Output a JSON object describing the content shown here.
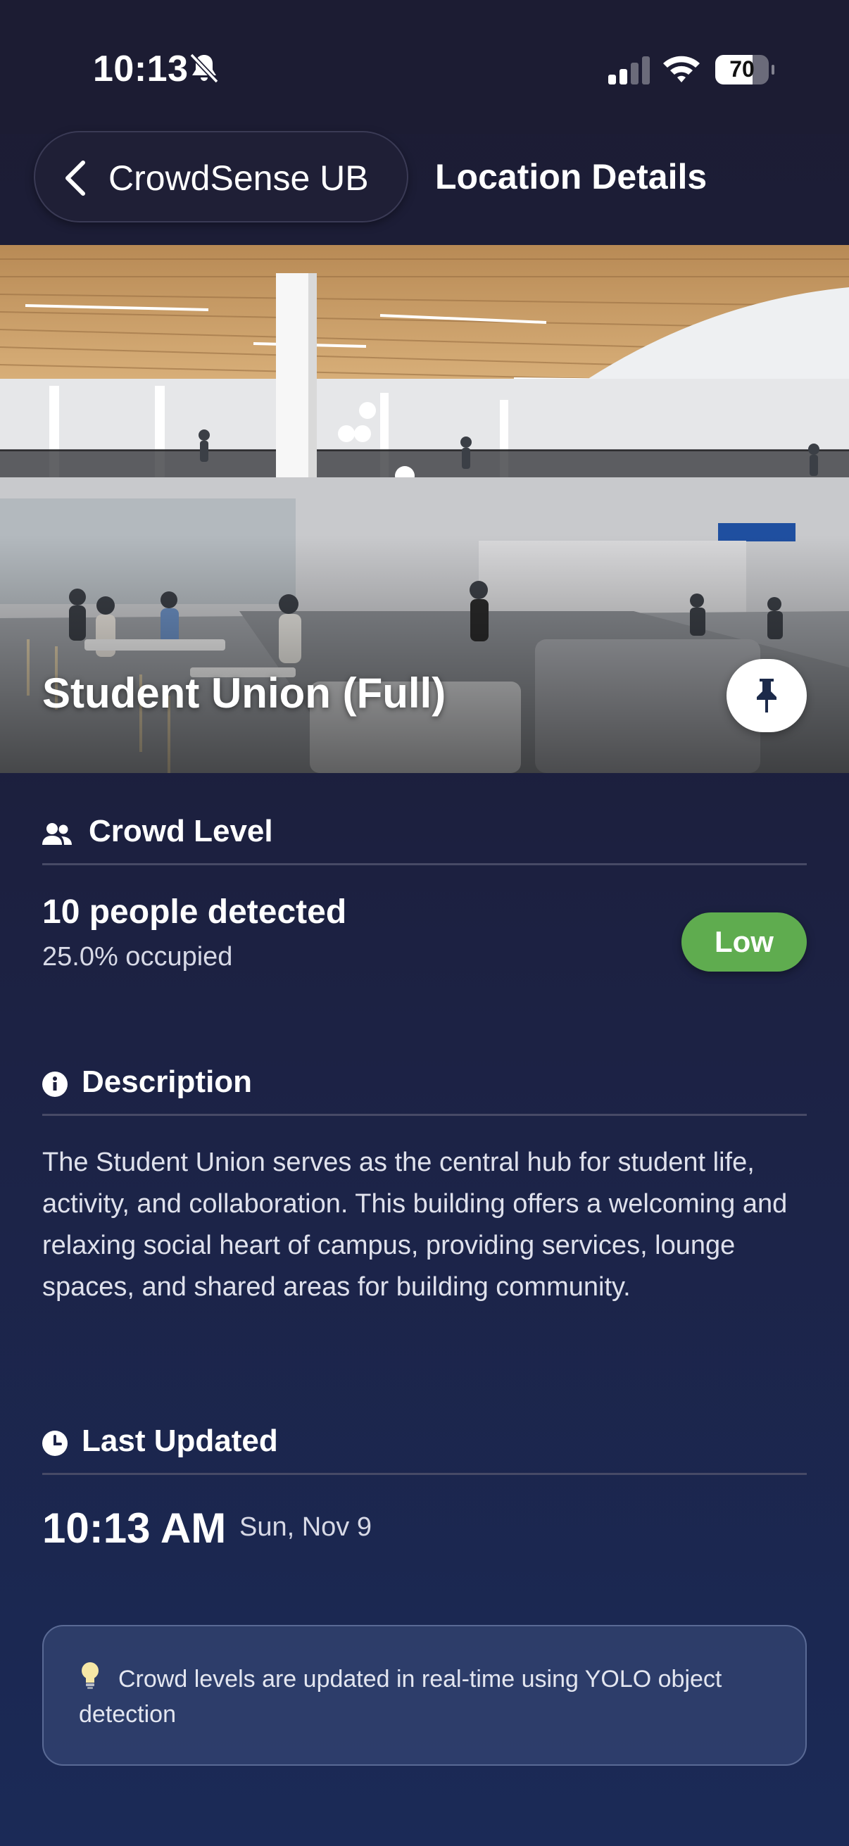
{
  "status_bar": {
    "time": "10:13",
    "battery": "70",
    "battery_level": 0.7,
    "icons": [
      "bell-slash-icon",
      "signal-icon",
      "wifi-icon",
      "battery-icon"
    ]
  },
  "nav": {
    "back_label": "CrowdSense UB",
    "title": "Location Details"
  },
  "location": {
    "name": "Student Union (Full)",
    "pin_icon": "pushpin-icon"
  },
  "crowd": {
    "heading": "Crowd Level",
    "count": "10 people detected",
    "occupancy": "25.0% occupied",
    "level": "Low",
    "level_color": "#5fac4f"
  },
  "description": {
    "heading": "Description",
    "text": "The Student Union serves as the central hub for student life, activity, and collaboration. This building offers a welcoming and relaxing social heart of campus, providing services, lounge spaces, and shared areas for building community."
  },
  "last_updated": {
    "heading": "Last Updated",
    "time": "10:13 AM",
    "date": "Sun, Nov 9"
  },
  "note": {
    "icon": "lightbulb-icon",
    "text": "Crowd levels are updated in real-time using YOLO object detection"
  },
  "colors": {
    "background_top": "#1c1c33",
    "background_bottom": "#1b2a57",
    "accent_low": "#5fac4f"
  }
}
